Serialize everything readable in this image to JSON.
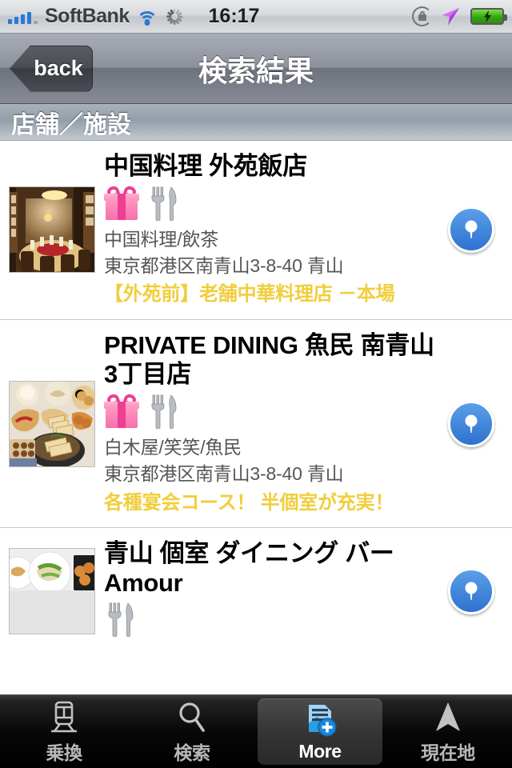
{
  "statusbar": {
    "carrier": "SoftBank",
    "time": "16:17",
    "signal_icon": "signal-bars-icon",
    "wifi_icon": "wifi-icon",
    "activity_icon": "activity-spinner-icon",
    "rotation_lock_icon": "rotation-lock-icon",
    "location_icon": "location-arrow-icon",
    "battery_icon": "battery-charging-icon"
  },
  "navbar": {
    "back_label": "back",
    "title": "検索結果"
  },
  "section_header": {
    "label": "店舗／施設"
  },
  "results": [
    {
      "title": "中国料理 外苑飯店",
      "genre": "中国料理/飲茶",
      "address": "東京都港区南青山3-8-40 青山",
      "promo": "【外苑前】老舗中華料理店 －本場",
      "badges": [
        "gift-icon",
        "cutlery-icon"
      ],
      "thumb_alt": "restaurant-private-room-photo",
      "map_button": "map-pin-button"
    },
    {
      "title": "PRIVATE DINING 魚民 南青山3丁目店",
      "genre": "白木屋/笑笑/魚民",
      "address": "東京都港区南青山3-8-40 青山",
      "promo": "各種宴会コース！ 半個室が充実！",
      "badges": [
        "gift-icon",
        "cutlery-icon"
      ],
      "thumb_alt": "japanese-food-spread-photo",
      "map_button": "map-pin-button"
    },
    {
      "title": "青山 個室 ダイニング バー　Amour",
      "genre": "",
      "address": "",
      "promo": "",
      "badges": [
        "cutlery-icon"
      ],
      "thumb_alt": "plated-dishes-photo",
      "map_button": "map-pin-button"
    }
  ],
  "tabbar": {
    "items": [
      {
        "label": "乗換",
        "icon": "train-icon",
        "selected": false
      },
      {
        "label": "検索",
        "icon": "search-icon",
        "selected": false
      },
      {
        "label": "More",
        "icon": "more-document-plus-icon",
        "selected": true
      },
      {
        "label": "現在地",
        "icon": "current-location-arrow-icon",
        "selected": false
      }
    ]
  },
  "colors": {
    "promo_gold": "#F0CE3C",
    "accent_blue": "#2D72D0",
    "carrier_blue": "#2B79D4",
    "battery_green": "#35A411",
    "location_purple": "#B23CE8"
  }
}
